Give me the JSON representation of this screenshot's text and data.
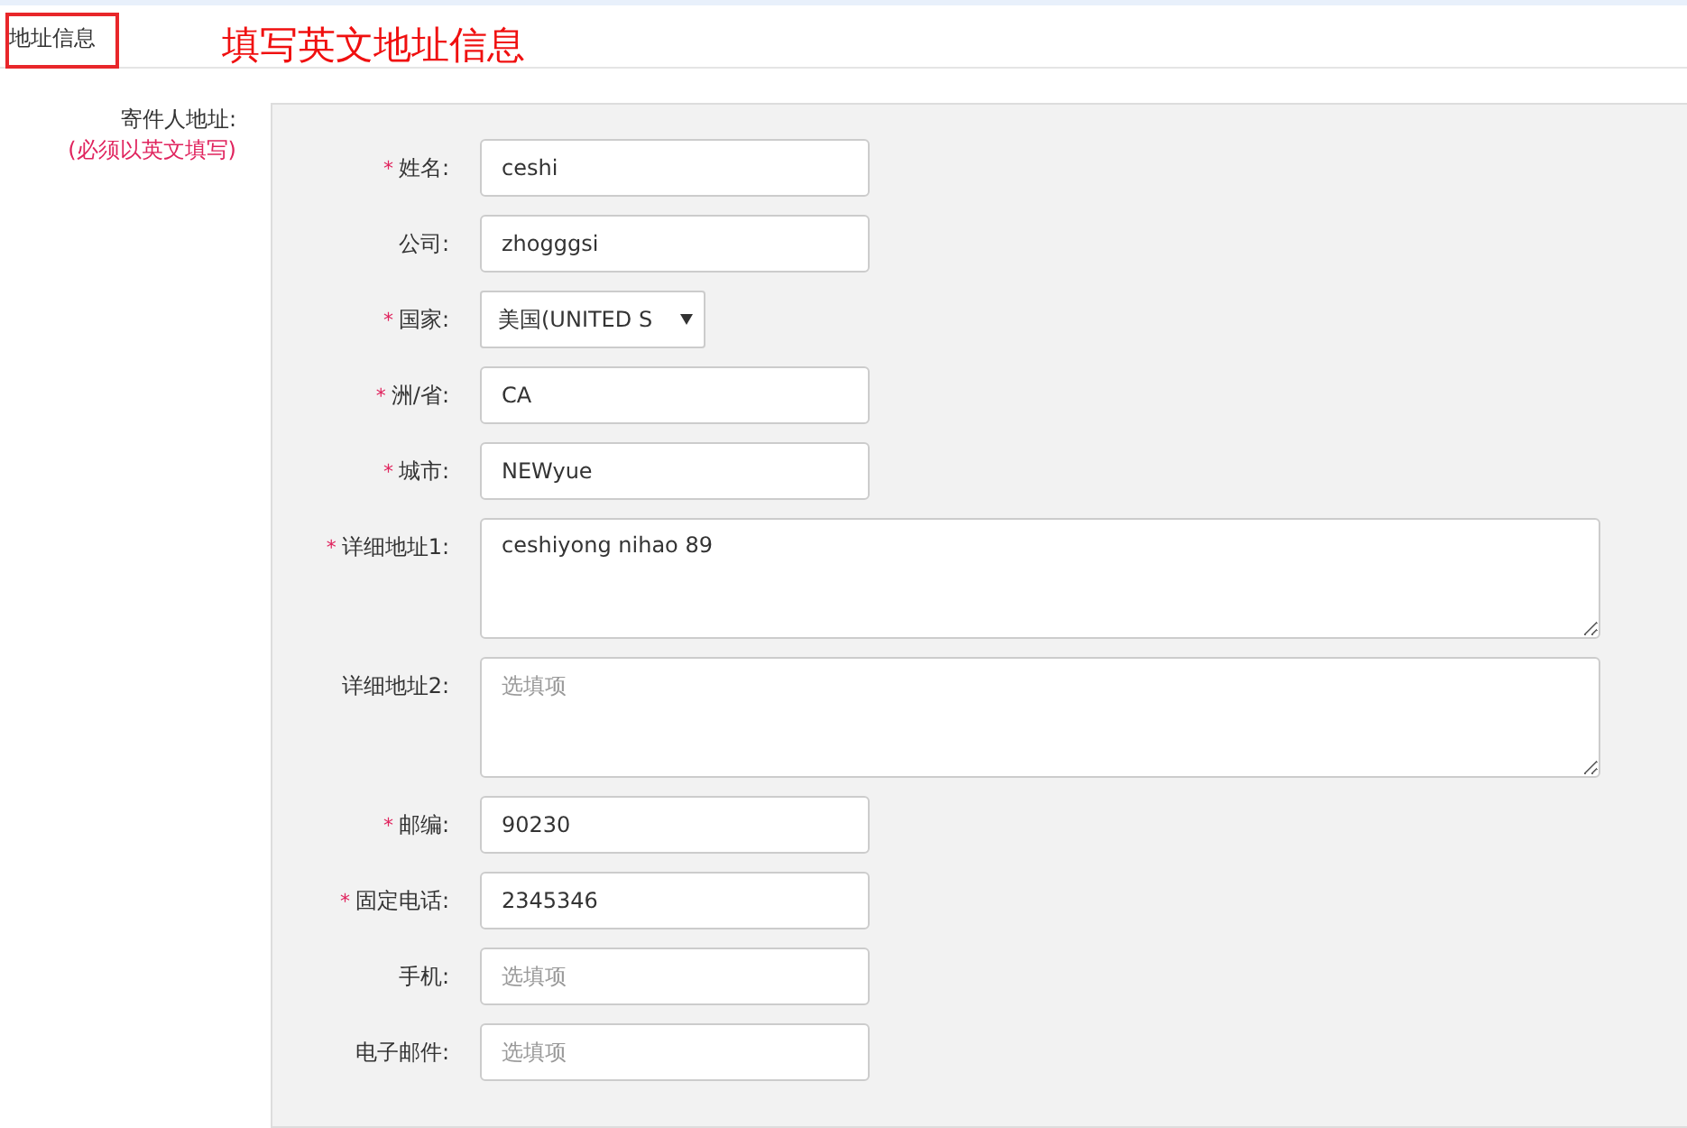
{
  "section_title": "地址信息",
  "annotation": "填写英文地址信息",
  "group": {
    "label": "寄件人地址:",
    "note": "(必须以英文填写)"
  },
  "fields": [
    {
      "kind": "input",
      "marker": "*",
      "label": "姓名:",
      "value": "ceshi"
    },
    {
      "kind": "input",
      "label": "公司:",
      "value": "zhogggsi"
    },
    {
      "kind": "select",
      "marker": "*",
      "label": "国家:",
      "value": "美国(UNITED S"
    },
    {
      "kind": "input",
      "marker": "*",
      "label": "洲/省:",
      "value": "CA"
    },
    {
      "kind": "input",
      "marker": "*",
      "label": "城市:",
      "value": "NEWyue"
    },
    {
      "kind": "textarea",
      "marker": "*",
      "label": "详细地址1:",
      "value": "ceshiyong nihao 89"
    },
    {
      "kind": "textarea",
      "label": "详细地址2:",
      "placeholder": "选填项"
    },
    {
      "kind": "input",
      "marker": "*",
      "label": "邮编:",
      "value": "90230"
    },
    {
      "kind": "input",
      "marker": "*",
      "label": "固定电话:",
      "value": "2345346"
    },
    {
      "kind": "input",
      "label": "手机:",
      "placeholder": "选填项"
    },
    {
      "kind": "input",
      "label": "电子邮件:",
      "placeholder": "选填项"
    }
  ]
}
